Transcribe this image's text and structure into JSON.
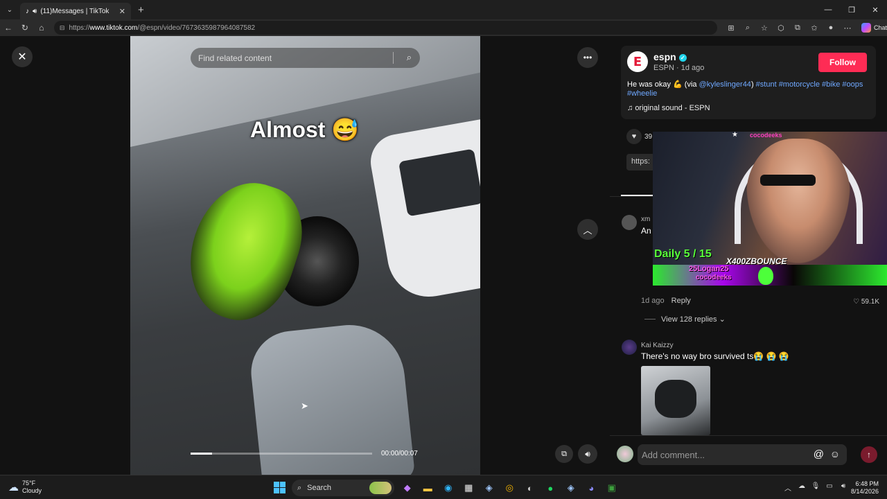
{
  "browser": {
    "tab_title": "(11)Messages | TikTok",
    "url_prefix": "https://",
    "url_host": "www.tiktok.com",
    "url_path": "/@espn/video/7673635987964087582",
    "copilot_label": "Chat"
  },
  "video": {
    "search_placeholder": "Find related content",
    "caption": "Almost 😅",
    "time": "00:00/00:07",
    "progress_fraction": 0.12
  },
  "post": {
    "username": "espn",
    "meta": "ESPN · 1d ago",
    "follow_label": "Follow",
    "desc_text": "He was okay 💪 (via ",
    "mention": "@kyleslinger44",
    "desc_close": ") ",
    "tags": "#stunt #motorcycle #bike #oops #wheelie",
    "sound": "original sound - ESPN",
    "like_count": "39",
    "link_text": "https:"
  },
  "comments": [
    {
      "author": "xm",
      "text": "An",
      "meta": "1d ago",
      "reply_label": "Reply",
      "likes": "59.1K",
      "view_replies": "View 128 replies"
    },
    {
      "author": "Kai Kaizzy",
      "text": "There's no way bro survived ts😭 😭 😭"
    }
  ],
  "comment_bar": {
    "placeholder": "Add comment..."
  },
  "stream_overlay": {
    "channel": "cocodeeks",
    "daily": "Daily 5 / 15",
    "name": "X400ZBOUNCE",
    "user_a": "25Logan25",
    "user_b": "cocodeeks"
  },
  "taskbar": {
    "temp": "75°F",
    "condition": "Cloudy",
    "search_label": "Search",
    "time": "6:48 PM",
    "date": "8/14/2026"
  },
  "colors": {
    "follow_button": "#fe2c55",
    "hashtag": "#6fa8ff",
    "verified": "#20d5ec"
  }
}
